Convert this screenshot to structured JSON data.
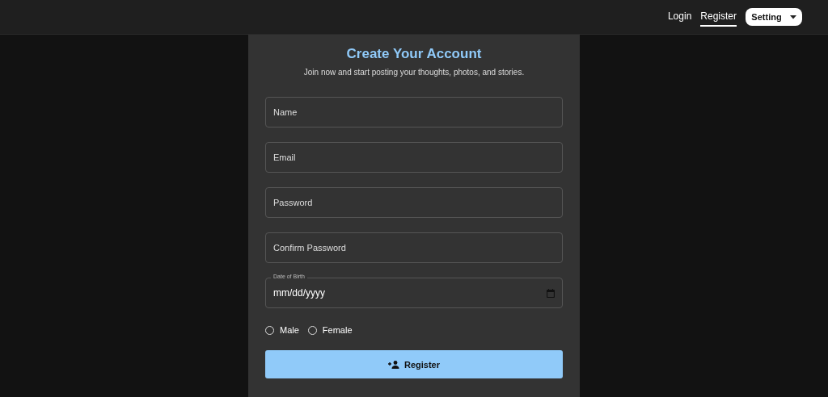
{
  "nav": {
    "links": [
      {
        "label": "Login",
        "selected": false
      },
      {
        "label": "Register",
        "selected": true
      }
    ],
    "settings_button": "Setting"
  },
  "form": {
    "title": "Create Your Account",
    "subtitle": "Join now and start posting your thoughts, photos, and stories.",
    "fields": [
      {
        "placeholder": "Name"
      },
      {
        "placeholder": "Email"
      },
      {
        "placeholder": "Password"
      },
      {
        "placeholder": "Confirm Password"
      }
    ],
    "date_field": {
      "label": "Date of Birth",
      "placeholder": "mm/dd/yyyy"
    },
    "gender_options": [
      {
        "label": "Male",
        "selected": false
      },
      {
        "label": "Female",
        "selected": false
      }
    ],
    "submit_button": "Register"
  }
}
